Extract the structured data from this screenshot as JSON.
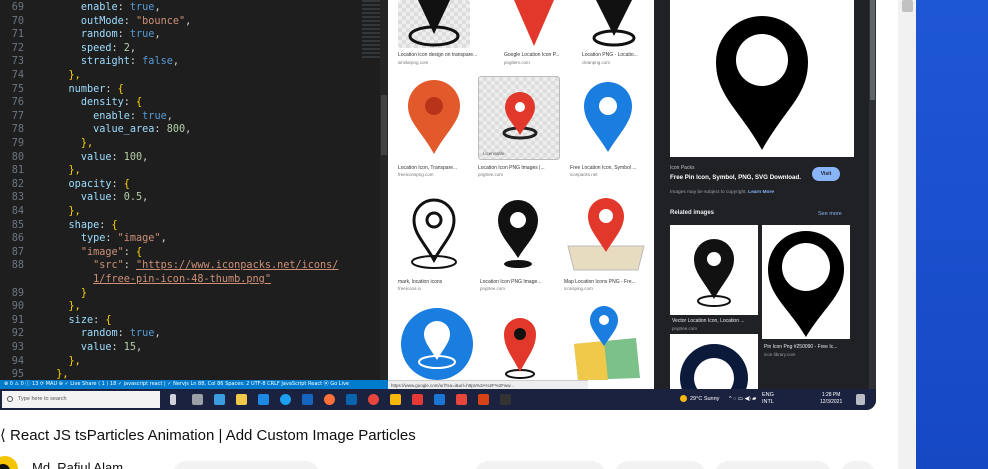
{
  "editor": {
    "line_numbers": [
      "69",
      "70",
      "71",
      "72",
      "73",
      "74",
      "75",
      "76",
      "77",
      "78",
      "79",
      "80",
      "81",
      "82",
      "83",
      "84",
      "85",
      "86",
      "87",
      "88",
      "",
      "89",
      "90",
      "91",
      "92",
      "93",
      "94",
      "95"
    ],
    "lines": [
      {
        "indent": "      ",
        "key": "enable",
        "sep": ": ",
        "val": "true",
        "vt": "b",
        "end": ","
      },
      {
        "indent": "      ",
        "key": "outMode",
        "sep": ": ",
        "val": "\"bounce\"",
        "vt": "s",
        "end": ","
      },
      {
        "indent": "      ",
        "key": "random",
        "sep": ": ",
        "val": "true",
        "vt": "b",
        "end": ","
      },
      {
        "indent": "      ",
        "key": "speed",
        "sep": ": ",
        "val": "2",
        "vt": "n",
        "end": ","
      },
      {
        "indent": "      ",
        "key": "straight",
        "sep": ": ",
        "val": "false",
        "vt": "b",
        "end": ","
      },
      {
        "indent": "    ",
        "key": "",
        "sep": "",
        "val": "},",
        "vt": "p",
        "end": ""
      },
      {
        "indent": "    ",
        "key": "number",
        "sep": ": ",
        "val": "{",
        "vt": "p",
        "end": ""
      },
      {
        "indent": "      ",
        "key": "density",
        "sep": ": ",
        "val": "{",
        "vt": "p",
        "end": ""
      },
      {
        "indent": "        ",
        "key": "enable",
        "sep": ": ",
        "val": "true",
        "vt": "b",
        "end": ","
      },
      {
        "indent": "        ",
        "key": "value_area",
        "sep": ": ",
        "val": "800",
        "vt": "n",
        "end": ","
      },
      {
        "indent": "      ",
        "key": "",
        "sep": "",
        "val": "},",
        "vt": "p",
        "end": ""
      },
      {
        "indent": "      ",
        "key": "value",
        "sep": ": ",
        "val": "100",
        "vt": "n",
        "end": ","
      },
      {
        "indent": "    ",
        "key": "",
        "sep": "",
        "val": "},",
        "vt": "p",
        "end": ""
      },
      {
        "indent": "    ",
        "key": "opacity",
        "sep": ": ",
        "val": "{",
        "vt": "p",
        "end": ""
      },
      {
        "indent": "      ",
        "key": "value",
        "sep": ": ",
        "val": "0.5",
        "vt": "n",
        "end": ","
      },
      {
        "indent": "    ",
        "key": "",
        "sep": "",
        "val": "},",
        "vt": "p",
        "end": ""
      },
      {
        "indent": "    ",
        "key": "shape",
        "sep": ": ",
        "val": "{",
        "vt": "p",
        "end": ""
      },
      {
        "indent": "      ",
        "key": "type",
        "sep": ": ",
        "val": "\"image\"",
        "vt": "s",
        "end": ","
      },
      {
        "indent": "      ",
        "key": "\"image\"",
        "sep": ": ",
        "val": "{",
        "vt": "p",
        "end": "",
        "keystr": true
      },
      {
        "indent": "        ",
        "key": "\"src\"",
        "sep": ": ",
        "val": "\"https://www.iconpacks.net/icons/",
        "vt": "u",
        "end": "",
        "keystr": true
      },
      {
        "indent": "        ",
        "key": "",
        "sep": "",
        "val": "1/free-pin-icon-48-thumb.png\"",
        "vt": "u",
        "end": ""
      },
      {
        "indent": "      ",
        "key": "",
        "sep": "",
        "val": "}",
        "vt": "p",
        "end": ""
      },
      {
        "indent": "    ",
        "key": "",
        "sep": "",
        "val": "},",
        "vt": "p",
        "end": ""
      },
      {
        "indent": "    ",
        "key": "size",
        "sep": ": ",
        "val": "{",
        "vt": "p",
        "end": ""
      },
      {
        "indent": "      ",
        "key": "random",
        "sep": ": ",
        "val": "true",
        "vt": "b",
        "end": ","
      },
      {
        "indent": "      ",
        "key": "value",
        "sep": ": ",
        "val": "15",
        "vt": "n",
        "end": ","
      },
      {
        "indent": "    ",
        "key": "",
        "sep": "",
        "val": "},",
        "vt": "p",
        "end": ""
      },
      {
        "indent": "  ",
        "key": "",
        "sep": "",
        "val": "},",
        "vt": "p",
        "end": ""
      }
    ],
    "status_bar": "⊗ 0 ⚠ 0 ⓘ 13   ⟳ MAU ⊕   ✓ Live Share   ⟨ 1 ⟩ 18   ✓ javascript react | ✓ Nervjs   Ln 88, Col 86   Spaces: 2   UTF-8   CRLF   JavaScript React   ⦿ Go Live"
  },
  "browser": {
    "results": [
      {
        "caption": "Location icon design on transpare...",
        "source": "similarpng.com"
      },
      {
        "caption": "Google Location Icon P...",
        "source": "pngitem.com"
      },
      {
        "caption": "Location PNG - Locatio...",
        "source": "cleanpng.com"
      },
      {
        "caption": "Location Icon, Transpare...",
        "source": "freeiconspng.com"
      },
      {
        "caption": "Location Icon PNG Images |...",
        "source": "pngtree.com"
      },
      {
        "caption": "Free Location Icon, Symbol ...",
        "source": "iconpacks.net"
      },
      {
        "caption": "mark, location icons",
        "source": "freeicons.io"
      },
      {
        "caption": "Location Icon PNG Image...",
        "source": "pngtree.com"
      },
      {
        "caption": "Map Location Icons PNG - Fre...",
        "source": "iconsping.com"
      }
    ],
    "licensable": "Licensable",
    "url_tooltip": "https://www.google.com/url?sa=i&url=https%3A%2F%2Fww...",
    "preview": {
      "site": "Icon Packs",
      "title": "Free Pin Icon, Symbol, PNG, SVG Download.",
      "visit": "Visit",
      "copyright": "Images may be subject to copyright.",
      "learn_more": "Learn More",
      "related": "Related images",
      "see_more": "See more",
      "related_items": [
        {
          "caption": "Vector Location Icon, Location ...",
          "source": "pngtree.com"
        },
        {
          "caption": "Pin Icon Png #250090 - Free Ic...",
          "source": "icon-library.com"
        }
      ]
    }
  },
  "taskbar": {
    "search_placeholder": "Type here to search",
    "weather": "29°C  Sunny",
    "lang": "ENG",
    "lang2": "INTL",
    "time": "1:28 PM",
    "date": "12/3/2021"
  },
  "video": {
    "title": "React JS tsParticles Animation | Add Custom Image Particles"
  },
  "channel": {
    "name": "Md. Rafiul Alam"
  },
  "colors": {
    "accent_blue": "#1e57d6",
    "pin_red": "#e2382b",
    "pin_blue": "#1a7de0"
  }
}
